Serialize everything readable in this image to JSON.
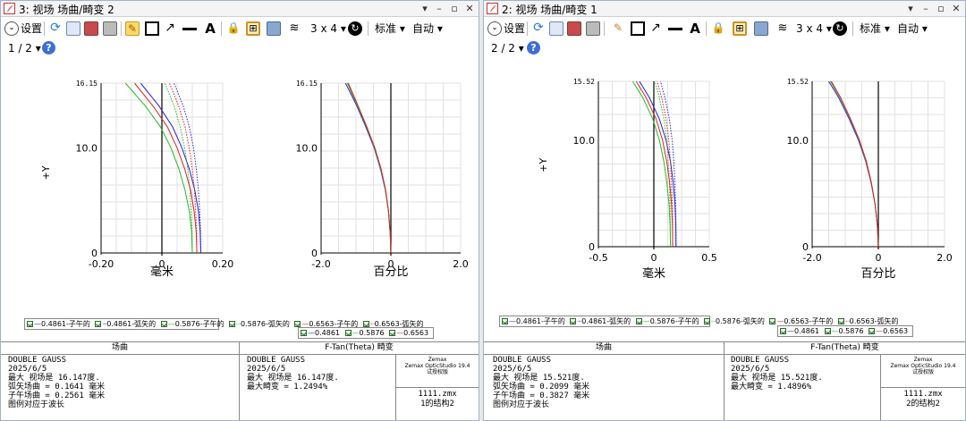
{
  "windows": [
    {
      "title": "3: 视场 场曲/畸变 2",
      "title_buttons": [
        "▾",
        "–",
        "▫",
        "✕"
      ],
      "toolbar": {
        "settings_label": "设置",
        "layout_label": "3 x 4",
        "standard_label": "标准",
        "auto_label": "自动",
        "page_label": "1 / 2"
      },
      "field_plot": {
        "y_max_label": "16.15",
        "y_mid_label": "10.0",
        "y_zero_label": "0",
        "y_axis_label": "+Y",
        "x_ticks": [
          "-0.20",
          "0",
          "0.20"
        ],
        "x_unit": "毫米"
      },
      "distortion_plot": {
        "y_max_label": "16.15",
        "y_mid_label": "10.0",
        "y_zero_label": "0",
        "x_ticks": [
          "-2.0",
          "0",
          "2.0"
        ],
        "x_unit": "百分比"
      },
      "legend_field": [
        "0.4861-子午的",
        "0.4861-弧矢的",
        "0.5876-子午的",
        "0.5876-弧矢的",
        "0.6563-子午的",
        "0.6563-弧矢的"
      ],
      "legend_dist": [
        "0.4861",
        "0.5876",
        "0.6563"
      ],
      "info": {
        "panel1_title": "场曲",
        "panel2_title": "F-Tan(Theta) 畸变",
        "lens_name": "DOUBLE GAUSS",
        "date": "2025/6/5",
        "field_max": "最大 视场是 16.147度.",
        "sagittal": "弧矢场曲 = 0.1641 毫米",
        "tangential": "子午场曲 = 0.2561 毫米",
        "legend_note": "图例对应于波长",
        "dist_max": "最大 视场是 16.147度.",
        "max_distortion": "最大畸变 = 1.2494%",
        "zemax_line1": "Zemax",
        "zemax_line2": "Zemax OpticStudio 19.4",
        "zemax_line3": "试授权版",
        "file": "1111.zmx",
        "config": "1的结构2"
      }
    },
    {
      "title": "2: 视场 场曲/畸变 1",
      "title_buttons": [
        "▾",
        "–",
        "▫",
        "✕"
      ],
      "toolbar": {
        "settings_label": "设置",
        "layout_label": "3 x 4",
        "standard_label": "标准",
        "auto_label": "自动",
        "page_label": "2 / 2"
      },
      "field_plot": {
        "y_max_label": "15.52",
        "y_mid_label": "10.0",
        "y_zero_label": "0",
        "y_axis_label": "+Y",
        "x_ticks": [
          "-0.5",
          "0",
          "0.5"
        ],
        "x_unit": "毫米"
      },
      "distortion_plot": {
        "y_max_label": "15.52",
        "y_mid_label": "10.0",
        "y_zero_label": "0",
        "x_ticks": [
          "-2.0",
          "0",
          "2.0"
        ],
        "x_unit": "百分比"
      },
      "legend_field": [
        "0.4861-子午的",
        "0.4861-弧矢的",
        "0.5876-子午的",
        "0.5876-弧矢的",
        "0.6563-子午的",
        "0.6563-弧矢的"
      ],
      "legend_dist": [
        "0.4861",
        "0.5876",
        "0.6563"
      ],
      "info": {
        "panel1_title": "场曲",
        "panel2_title": "F-Tan(Theta) 畸变",
        "lens_name": "DOUBLE GAUSS",
        "date": "2025/6/5",
        "field_max": "最大 视场是 15.521度.",
        "sagittal": "弧矢场曲 = 0.2099 毫米",
        "tangential": "子午场曲 = 0.3827 毫米",
        "legend_note": "图例对应于波长",
        "dist_max": "最大 视场是 15.521度.",
        "max_distortion": "最大畸变 = 1.4896%",
        "zemax_line1": "Zemax",
        "zemax_line2": "Zemax OpticStudio 19.4",
        "zemax_line3": "试授权版",
        "file": "1111.zmx",
        "config": "2的结构2"
      }
    }
  ],
  "colors": {
    "blue": "#2222dd",
    "green": "#22bb22",
    "red": "#dd2222",
    "black": "#111111"
  },
  "chart_data": [
    {
      "type": "line",
      "title": "场曲",
      "window": 0,
      "xlabel": "毫米",
      "ylabel": "+Y",
      "xlim": [
        -0.2,
        0.2
      ],
      "ylim": [
        0,
        16.15
      ],
      "y": [
        0,
        2,
        4,
        6,
        8,
        10,
        12,
        14,
        16.15
      ],
      "series": [
        {
          "name": "0.4861-子午的",
          "color": "#2222dd",
          "x": [
            0.128,
            0.126,
            0.12,
            0.108,
            0.09,
            0.066,
            0.035,
            -0.01,
            -0.07
          ]
        },
        {
          "name": "0.4861-弧矢的",
          "color": "#2222dd",
          "x": [
            0.128,
            0.127,
            0.124,
            0.12,
            0.113,
            0.104,
            0.09,
            0.07,
            0.04
          ]
        },
        {
          "name": "0.5876-子午的",
          "color": "#22bb22",
          "x": [
            0.1,
            0.098,
            0.09,
            0.076,
            0.056,
            0.03,
            -0.005,
            -0.055,
            -0.12
          ]
        },
        {
          "name": "0.5876-弧矢的",
          "color": "#22bb22",
          "x": [
            0.1,
            0.099,
            0.096,
            0.092,
            0.085,
            0.075,
            0.06,
            0.04,
            0.01
          ]
        },
        {
          "name": "0.6563-子午的",
          "color": "#dd2222",
          "x": [
            0.115,
            0.113,
            0.106,
            0.094,
            0.075,
            0.05,
            0.018,
            -0.03,
            -0.09
          ]
        },
        {
          "name": "0.6563-弧矢的",
          "color": "#dd2222",
          "x": [
            0.115,
            0.114,
            0.111,
            0.107,
            0.1,
            0.09,
            0.076,
            0.055,
            0.025
          ]
        }
      ]
    },
    {
      "type": "line",
      "title": "F-Tan(Theta) 畸变",
      "window": 0,
      "xlabel": "百分比",
      "ylabel": "+Y",
      "xlim": [
        -2.0,
        2.0
      ],
      "ylim": [
        0,
        16.15
      ],
      "y": [
        0,
        2,
        4,
        6,
        8,
        10,
        12,
        14,
        16.15
      ],
      "series": [
        {
          "name": "0.4861",
          "color": "#2222dd",
          "x": [
            0,
            -0.02,
            -0.07,
            -0.16,
            -0.3,
            -0.48,
            -0.72,
            -0.98,
            -1.3
          ]
        },
        {
          "name": "0.5876",
          "color": "#22bb22",
          "x": [
            0,
            -0.02,
            -0.07,
            -0.15,
            -0.29,
            -0.47,
            -0.7,
            -0.96,
            -1.25
          ]
        },
        {
          "name": "0.6563",
          "color": "#dd2222",
          "x": [
            0,
            -0.02,
            -0.07,
            -0.15,
            -0.28,
            -0.46,
            -0.69,
            -0.94,
            -1.22
          ]
        }
      ]
    },
    {
      "type": "line",
      "title": "场曲",
      "window": 1,
      "xlabel": "毫米",
      "ylabel": "+Y",
      "xlim": [
        -0.5,
        0.5
      ],
      "ylim": [
        0,
        15.52
      ],
      "y": [
        0,
        2,
        4,
        6,
        8,
        10,
        12,
        14,
        15.52
      ],
      "series": [
        {
          "name": "0.4861-子午的",
          "color": "#2222dd",
          "x": [
            0.2,
            0.198,
            0.19,
            0.175,
            0.15,
            0.11,
            0.05,
            -0.04,
            -0.13
          ]
        },
        {
          "name": "0.4861-弧矢的",
          "color": "#2222dd",
          "x": [
            0.2,
            0.199,
            0.196,
            0.19,
            0.18,
            0.165,
            0.14,
            0.1,
            0.06
          ]
        },
        {
          "name": "0.5876-子午的",
          "color": "#22bb22",
          "x": [
            0.15,
            0.147,
            0.137,
            0.118,
            0.09,
            0.05,
            -0.01,
            -0.1,
            -0.19
          ]
        },
        {
          "name": "0.5876-弧矢的",
          "color": "#22bb22",
          "x": [
            0.15,
            0.149,
            0.146,
            0.14,
            0.13,
            0.115,
            0.09,
            0.05,
            0.01
          ]
        },
        {
          "name": "0.6563-子午的",
          "color": "#dd2222",
          "x": [
            0.17,
            0.168,
            0.16,
            0.143,
            0.116,
            0.078,
            0.02,
            -0.07,
            -0.16
          ]
        },
        {
          "name": "0.6563-弧矢的",
          "color": "#dd2222",
          "x": [
            0.17,
            0.169,
            0.166,
            0.16,
            0.15,
            0.135,
            0.11,
            0.07,
            0.03
          ]
        }
      ]
    },
    {
      "type": "line",
      "title": "F-Tan(Theta) 畸变",
      "window": 1,
      "xlabel": "百分比",
      "ylabel": "+Y",
      "xlim": [
        -2.0,
        2.0
      ],
      "ylim": [
        0,
        15.52
      ],
      "y": [
        0,
        2,
        4,
        6,
        8,
        10,
        12,
        14,
        15.52
      ],
      "series": [
        {
          "name": "0.4861",
          "color": "#2222dd",
          "x": [
            0,
            -0.03,
            -0.1,
            -0.22,
            -0.38,
            -0.6,
            -0.88,
            -1.2,
            -1.5
          ]
        },
        {
          "name": "0.5876",
          "color": "#22bb22",
          "x": [
            0,
            -0.03,
            -0.1,
            -0.21,
            -0.37,
            -0.58,
            -0.85,
            -1.16,
            -1.45
          ]
        },
        {
          "name": "0.6563",
          "color": "#dd2222",
          "x": [
            0,
            -0.03,
            -0.1,
            -0.21,
            -0.36,
            -0.57,
            -0.84,
            -1.14,
            -1.42
          ]
        }
      ]
    }
  ]
}
